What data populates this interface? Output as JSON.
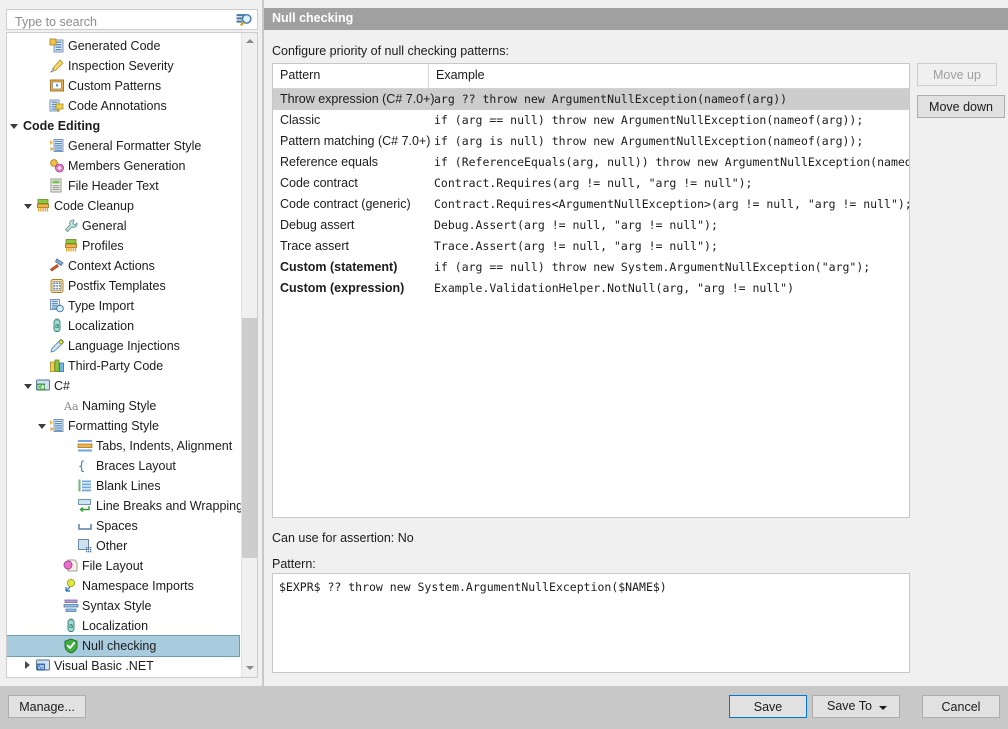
{
  "search": {
    "placeholder": "Type to search",
    "value": "",
    "icon": "search-icon"
  },
  "tree": {
    "items": [
      {
        "label": "Generated Code",
        "indent": 2,
        "icon": "generated-code-icon",
        "triangle": "none",
        "bold": false,
        "selected": false
      },
      {
        "label": "Inspection Severity",
        "indent": 2,
        "icon": "inspection-severity-icon",
        "triangle": "none",
        "bold": false,
        "selected": false
      },
      {
        "label": "Custom Patterns",
        "indent": 2,
        "icon": "custom-patterns-icon",
        "triangle": "none",
        "bold": false,
        "selected": false
      },
      {
        "label": "Code Annotations",
        "indent": 2,
        "icon": "code-annotations-icon",
        "triangle": "none",
        "bold": false,
        "selected": false
      },
      {
        "label": "Code Editing",
        "indent": 0,
        "icon": "none",
        "triangle": "open",
        "bold": true,
        "selected": false
      },
      {
        "label": "General Formatter Style",
        "indent": 2,
        "icon": "formatter-style-icon",
        "triangle": "none",
        "bold": false,
        "selected": false
      },
      {
        "label": "Members Generation",
        "indent": 2,
        "icon": "members-generation-icon",
        "triangle": "none",
        "bold": false,
        "selected": false
      },
      {
        "label": "File Header Text",
        "indent": 2,
        "icon": "file-header-icon",
        "triangle": "none",
        "bold": false,
        "selected": false
      },
      {
        "label": "Code Cleanup",
        "indent": 1,
        "icon": "code-cleanup-icon",
        "triangle": "open",
        "bold": false,
        "selected": false
      },
      {
        "label": "General",
        "indent": 3,
        "icon": "wrench-icon",
        "triangle": "none",
        "bold": false,
        "selected": false
      },
      {
        "label": "Profiles",
        "indent": 3,
        "icon": "profiles-icon",
        "triangle": "none",
        "bold": false,
        "selected": false
      },
      {
        "label": "Context Actions",
        "indent": 2,
        "icon": "hammer-icon",
        "triangle": "none",
        "bold": false,
        "selected": false
      },
      {
        "label": "Postfix Templates",
        "indent": 2,
        "icon": "postfix-templates-icon",
        "triangle": "none",
        "bold": false,
        "selected": false
      },
      {
        "label": "Type Import",
        "indent": 2,
        "icon": "type-import-icon",
        "triangle": "none",
        "bold": false,
        "selected": false
      },
      {
        "label": "Localization",
        "indent": 2,
        "icon": "localization-icon",
        "triangle": "none",
        "bold": false,
        "selected": false
      },
      {
        "label": "Language Injections",
        "indent": 2,
        "icon": "language-injections-icon",
        "triangle": "none",
        "bold": false,
        "selected": false
      },
      {
        "label": "Third-Party Code",
        "indent": 2,
        "icon": "third-party-code-icon",
        "triangle": "none",
        "bold": false,
        "selected": false
      },
      {
        "label": "C#",
        "indent": 1,
        "icon": "csharp-icon",
        "triangle": "open",
        "bold": false,
        "selected": false
      },
      {
        "label": "Naming Style",
        "indent": 3,
        "icon": "naming-style-icon",
        "triangle": "none",
        "bold": false,
        "selected": false
      },
      {
        "label": "Formatting Style",
        "indent": 2,
        "icon": "formatting-style-icon",
        "triangle": "open",
        "bold": false,
        "selected": false
      },
      {
        "label": "Tabs, Indents, Alignment",
        "indent": 4,
        "icon": "tabs-indents-icon",
        "triangle": "none",
        "bold": false,
        "selected": false
      },
      {
        "label": "Braces Layout",
        "indent": 4,
        "icon": "braces-layout-icon",
        "triangle": "none",
        "bold": false,
        "selected": false
      },
      {
        "label": "Blank Lines",
        "indent": 4,
        "icon": "blank-lines-icon",
        "triangle": "none",
        "bold": false,
        "selected": false
      },
      {
        "label": "Line Breaks and Wrapping",
        "indent": 4,
        "icon": "line-breaks-icon",
        "triangle": "none",
        "bold": false,
        "selected": false
      },
      {
        "label": "Spaces",
        "indent": 4,
        "icon": "spaces-icon",
        "triangle": "none",
        "bold": false,
        "selected": false
      },
      {
        "label": "Other",
        "indent": 4,
        "icon": "other-icon",
        "triangle": "none",
        "bold": false,
        "selected": false
      },
      {
        "label": "File Layout",
        "indent": 3,
        "icon": "file-layout-icon",
        "triangle": "none",
        "bold": false,
        "selected": false
      },
      {
        "label": "Namespace Imports",
        "indent": 3,
        "icon": "namespace-imports-icon",
        "triangle": "none",
        "bold": false,
        "selected": false
      },
      {
        "label": "Syntax Style",
        "indent": 3,
        "icon": "syntax-style-icon",
        "triangle": "none",
        "bold": false,
        "selected": false
      },
      {
        "label": "Localization",
        "indent": 3,
        "icon": "localization-icon",
        "triangle": "none",
        "bold": false,
        "selected": false
      },
      {
        "label": "Null checking",
        "indent": 3,
        "icon": "shield-check-icon",
        "triangle": "none",
        "bold": false,
        "selected": true
      },
      {
        "label": "Visual Basic .NET",
        "indent": 1,
        "icon": "vb-net-icon",
        "triangle": "closed",
        "bold": false,
        "selected": false
      }
    ]
  },
  "header": {
    "title": "Null checking"
  },
  "main": {
    "hint": "Configure priority of null checking patterns:",
    "table": {
      "columns": [
        "Pattern",
        "Example"
      ],
      "rows": [
        {
          "pattern": "Throw expression (C# 7.0+)",
          "example": "arg ?? throw new ArgumentNullException(nameof(arg))",
          "selected": true,
          "custom": false
        },
        {
          "pattern": "Classic",
          "example": "if (arg == null) throw new ArgumentNullException(nameof(arg));",
          "selected": false,
          "custom": false
        },
        {
          "pattern": "Pattern matching (C# 7.0+)",
          "example": "if (arg is null) throw new ArgumentNullException(nameof(arg));",
          "selected": false,
          "custom": false
        },
        {
          "pattern": "Reference equals",
          "example": "if (ReferenceEquals(arg, null)) throw new ArgumentNullException(nameof(arg));",
          "selected": false,
          "custom": false
        },
        {
          "pattern": "Code contract",
          "example": "Contract.Requires(arg != null, \"arg != null\");",
          "selected": false,
          "custom": false
        },
        {
          "pattern": "Code contract (generic)",
          "example": "Contract.Requires<ArgumentNullException>(arg != null, \"arg != null\");",
          "selected": false,
          "custom": false
        },
        {
          "pattern": "Debug assert",
          "example": "Debug.Assert(arg != null, \"arg != null\");",
          "selected": false,
          "custom": false
        },
        {
          "pattern": "Trace assert",
          "example": "Trace.Assert(arg != null, \"arg != null\");",
          "selected": false,
          "custom": false
        },
        {
          "pattern": "Custom (statement)",
          "example": "if (arg == null) throw new System.ArgumentNullException(\"arg\");",
          "selected": false,
          "custom": true
        },
        {
          "pattern": "Custom (expression)",
          "example": "Example.ValidationHelper.NotNull(arg, \"arg != null\")",
          "selected": false,
          "custom": true
        }
      ]
    },
    "move_up_label": "Move up",
    "move_down_label": "Move down",
    "assertion_line": "Can use for assertion: No",
    "pattern_label": "Pattern:",
    "pattern_value": "$EXPR$ ?? throw new System.ArgumentNullException($NAME$)"
  },
  "footer": {
    "manage_label": "Manage...",
    "save_label": "Save",
    "save_to_label": "Save To",
    "cancel_label": "Cancel"
  },
  "colors": {
    "accent": "#0078d7",
    "title_bar": "#a0a0a0",
    "selection": "#a8cbde",
    "row_selection": "#cdcdcd",
    "window": "#f0f0f0",
    "dialog_chrome": "#c8c8c8"
  }
}
